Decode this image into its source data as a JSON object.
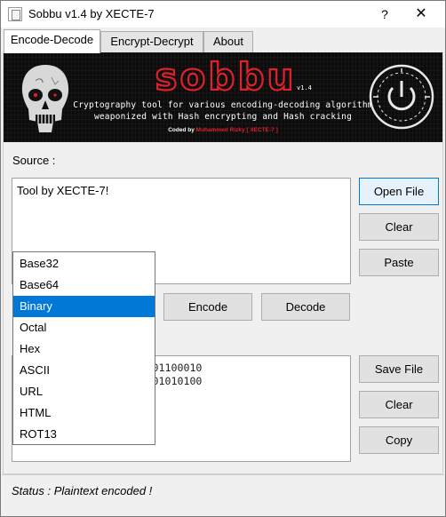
{
  "window": {
    "title": "Sobbu v1.4 by XECTE-7",
    "help_label": "?",
    "close_label": "✕"
  },
  "tabs": [
    "Encode-Decode",
    "Encrypt-Decrypt",
    "About"
  ],
  "banner": {
    "brand": "sobbu",
    "version": "v1.4",
    "tagline_line1": "Cryptography tool for various encoding-decoding algorithm",
    "tagline_line2": "weaponized with Hash encrypting and Hash cracking",
    "coded_prefix": "Coded by",
    "coded_author": "Muhammed Rizky [ XECTE-7 ]"
  },
  "source": {
    "label": "Source :",
    "value": "Tool by XECTE-7!"
  },
  "buttons": {
    "open_file": "Open File",
    "clear_source": "Clear",
    "paste": "Paste",
    "encode": "Encode",
    "decode": "Decode",
    "save_file": "Save File",
    "clear_output": "Clear",
    "copy": "Copy"
  },
  "encoding_dropdown": {
    "options": [
      "Base32",
      "Base64",
      "Binary",
      "Octal",
      "Hex",
      "ASCII",
      "URL",
      "HTML",
      "ROT13"
    ],
    "selected": "Binary"
  },
  "output": {
    "lines": [
      "111 01101100 00100000 01100010",
      "000 01001001 01000011 01010100",
      "111 00100001"
    ]
  },
  "status": {
    "text": "Status : Plaintext encoded !"
  },
  "colors": {
    "accent_red": "#e0212b",
    "selection_blue": "#0078d7",
    "banner_bg": "#0c0c0c"
  }
}
